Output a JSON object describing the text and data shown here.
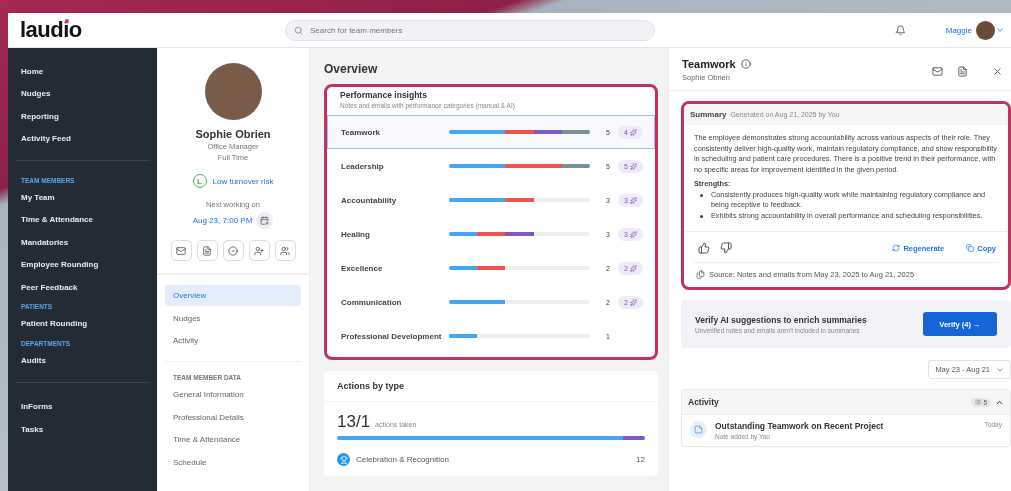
{
  "app": {
    "logo": "laudio"
  },
  "search": {
    "placeholder": "Search for team members"
  },
  "user": {
    "name": "Maggie"
  },
  "sidebar": {
    "sections": [
      {
        "items": [
          "Home",
          "Nudges",
          "Reporting",
          "Activity Feed"
        ]
      },
      {
        "heading": "TEAM MEMBERS",
        "items": [
          "My Team",
          "Time & Attendance",
          "Mandatories",
          "Employee Rounding",
          "Peer Feedback"
        ]
      },
      {
        "heading": "PATIENTS",
        "items": [
          "Patient Rounding"
        ]
      },
      {
        "heading": "DEPARTMENTS",
        "items": [
          "Audits"
        ]
      },
      {
        "items": [
          "InForms",
          "Tasks"
        ]
      }
    ]
  },
  "profile": {
    "name": "Sophie Obrien",
    "role": "Office Manager",
    "employment": "Full Time",
    "risk_badge": "L",
    "risk": "Low turnover risk",
    "next_label": "Next working on",
    "next_time": "Aug 23, 7:00 PM"
  },
  "profile_nav": {
    "items": [
      {
        "label": "Overview",
        "selected": true
      },
      {
        "label": "Nudges",
        "selected": false
      },
      {
        "label": "Activity",
        "selected": false
      }
    ],
    "section_heading": "TEAM MEMBER DATA",
    "data_items": [
      "General Information",
      "Professional Details",
      "Time & Attendance",
      "Schedule"
    ]
  },
  "overview": {
    "title": "Overview",
    "insights": {
      "title": "Performance insights",
      "subtitle": "Notes and emails with performance categories (manual & AI)",
      "rows": [
        {
          "name": "Teamwork",
          "count": "5",
          "ai_count": "4",
          "selected": true,
          "units": [
            {
              "color": "#42a5f5"
            },
            {
              "color": "#42a5f5"
            },
            {
              "color": "#ef5350"
            },
            {
              "color": "#7e57c2"
            },
            {
              "color": "#78909c"
            }
          ]
        },
        {
          "name": "Leadership",
          "count": "5",
          "ai_count": "5",
          "selected": false,
          "units": [
            {
              "color": "#42a5f5"
            },
            {
              "color": "#42a5f5"
            },
            {
              "color": "#ef5350"
            },
            {
              "color": "#ef5350"
            },
            {
              "color": "#78909c"
            }
          ]
        },
        {
          "name": "Accountability",
          "count": "3",
          "ai_count": "3",
          "selected": false,
          "units": [
            {
              "color": "#42a5f5"
            },
            {
              "color": "#42a5f5"
            },
            {
              "color": "#ef5350"
            }
          ]
        },
        {
          "name": "Healing",
          "count": "3",
          "ai_count": "3",
          "selected": false,
          "units": [
            {
              "color": "#42a5f5"
            },
            {
              "color": "#ef5350"
            },
            {
              "color": "#7e57c2"
            }
          ]
        },
        {
          "name": "Excellence",
          "count": "2",
          "ai_count": "2",
          "selected": false,
          "units": [
            {
              "color": "#42a5f5"
            },
            {
              "color": "#ef5350"
            }
          ]
        },
        {
          "name": "Communication",
          "count": "2",
          "ai_count": "2",
          "selected": false,
          "units": [
            {
              "color": "#42a5f5"
            },
            {
              "color": "#42a5f5"
            }
          ]
        },
        {
          "name": "Professional Development",
          "count": "1",
          "selected": false,
          "units": [
            {
              "color": "#42a5f5"
            }
          ]
        }
      ]
    },
    "actions": {
      "title": "Actions by type",
      "total": "13/1",
      "total_label": "actions taken",
      "units": [
        {
          "color": "#42a5f5"
        },
        {
          "color": "#42a5f5"
        },
        {
          "color": "#42a5f5"
        },
        {
          "color": "#42a5f5"
        },
        {
          "color": "#42a5f5"
        },
        {
          "color": "#42a5f5"
        },
        {
          "color": "#42a5f5"
        },
        {
          "color": "#42a5f5"
        },
        {
          "color": "#42a5f5"
        },
        {
          "color": "#42a5f5"
        },
        {
          "color": "#42a5f5"
        },
        {
          "color": "#42a5f5"
        },
        {
          "color": "#42a5f5"
        },
        {
          "color": "#7e57c2"
        }
      ],
      "items": [
        {
          "label": "Celebration & Recognition",
          "count": "12",
          "color": "#2196f3"
        }
      ]
    }
  },
  "detail": {
    "title": "Teamwork",
    "subtitle": "Sophie Obrien",
    "summary": {
      "title": "Summary",
      "generated": "Generated on Aug 21, 2025 by You",
      "body": "The employee demonstrates strong accountability across various aspects of their role. They consistently deliver high-quality work, maintain regulatory compliance, and show responsibility in scheduling and patient care procedures. There is a positive trend in their performance, with no specific areas for improvement identified in the given period.",
      "strengths_label": "Strengths:",
      "strengths": [
        "Consistently produces high-quality work while maintaining regulatory compliance and being receptive to feedback.",
        "Exhibits strong accountability in overall performance and scheduling responsibilities."
      ],
      "regenerate": "Regenerate",
      "copy": "Copy",
      "source": "Source: Notes and emails from May 23, 2025 to Aug 21, 2025"
    },
    "verify": {
      "title": "Verify AI suggestions to enrich summaries",
      "subtitle": "Unverified notes and emails aren't included in summaries",
      "button": "Verify (4) →"
    },
    "date_range": "May 23 - Aug 21",
    "activity": {
      "title": "Activity",
      "count": "5",
      "expanded": true,
      "items": [
        {
          "title": "Outstanding Teamwork on Recent Project",
          "meta": "Note added by You",
          "time": "Today"
        }
      ]
    }
  }
}
